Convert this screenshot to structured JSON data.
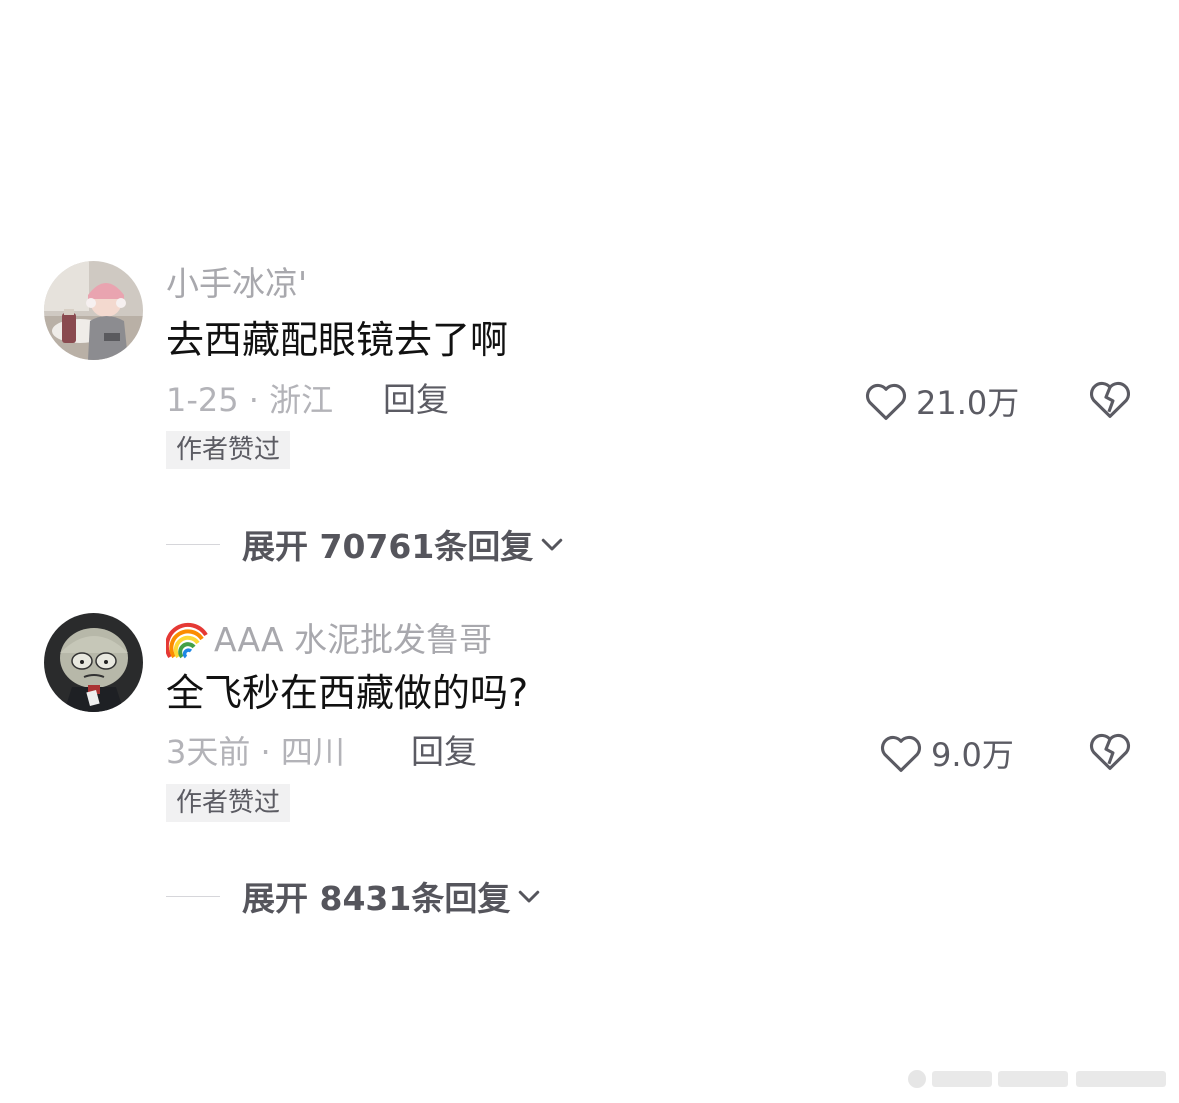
{
  "comments": [
    {
      "username": "小手冰凉'",
      "text": "去西藏配眼镜去了啊",
      "date_location": "1-25 · 浙江",
      "reply_label": "回复",
      "likes": "21.0万",
      "badge": "作者赞过",
      "expand_label": "展开 70761条回复"
    },
    {
      "username": "AAA 水泥批发鲁哥",
      "text": "全飞秒在西藏做的吗?",
      "date_location": "3天前 · 四川",
      "reply_label": "回复",
      "likes": "9.0万",
      "badge": "作者赞过",
      "expand_label": "展开 8431条回复"
    }
  ],
  "colors": {
    "username": "#a8a8ad",
    "meta": "#b3b3b8",
    "action": "#5b5b63",
    "badge_bg": "#f1f1f2"
  },
  "icons": {
    "like": "heart-outline-icon",
    "dislike": "broken-heart-icon",
    "expand": "chevron-down-icon",
    "username_prefix": "rainbow-emoji-icon"
  }
}
